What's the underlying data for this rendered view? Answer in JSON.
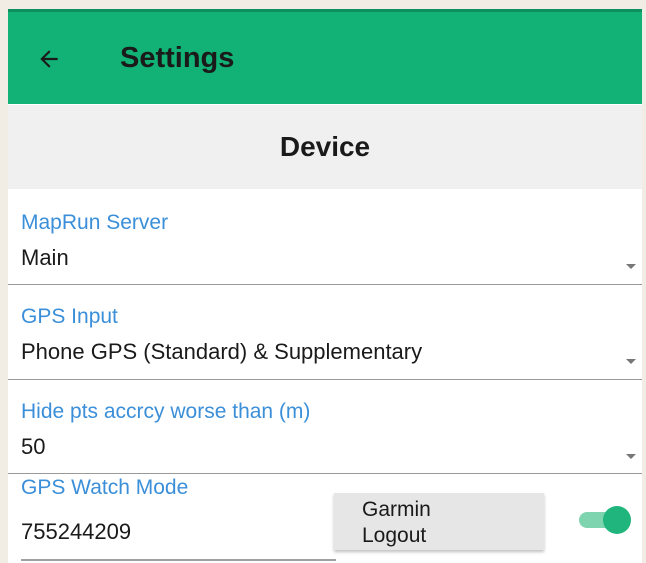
{
  "appbar": {
    "title": "Settings",
    "back_icon": "arrow-left-icon",
    "color": "#12b176"
  },
  "section": {
    "title": "Device"
  },
  "fields": [
    {
      "label": "MapRun Server",
      "value": "Main"
    },
    {
      "label": "GPS Input",
      "value": "Phone GPS (Standard) & Supplementary"
    },
    {
      "label": "Hide pts accrcy worse than (m)",
      "value": "50"
    }
  ],
  "watch": {
    "label": "GPS Watch Mode",
    "value": "755244209",
    "button_label": "Garmin Logout",
    "toggle_on": true
  },
  "colors": {
    "label_blue": "#3b8fd9",
    "accent_green": "#12b176"
  }
}
